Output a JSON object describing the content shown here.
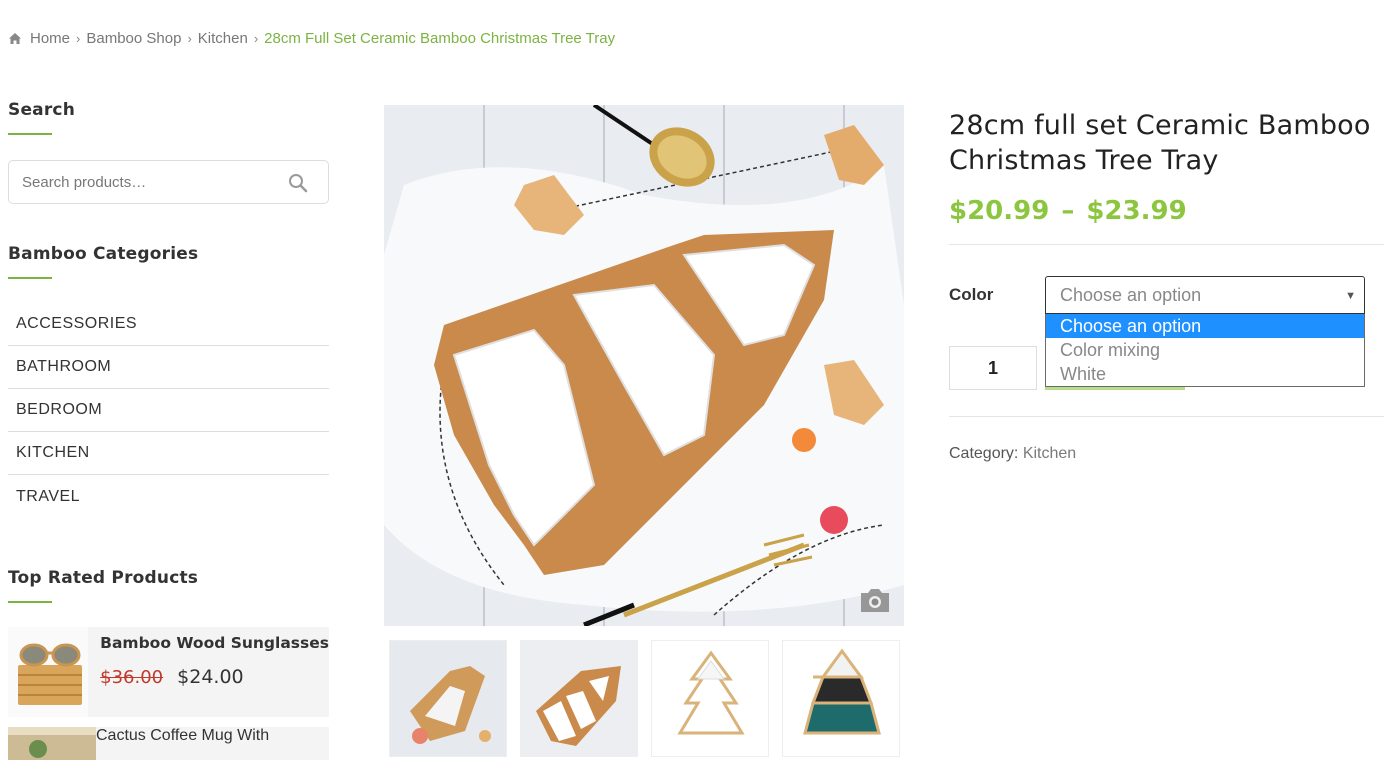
{
  "breadcrumb": {
    "home": "Home",
    "shop": "Bamboo Shop",
    "category": "Kitchen",
    "current": "28cm Full Set Ceramic Bamboo Christmas Tree Tray"
  },
  "sidebar": {
    "search": {
      "title": "Search",
      "placeholder": "Search products…"
    },
    "categories": {
      "title": "Bamboo Categories",
      "items": [
        "ACCESSORIES",
        "BATHROOM",
        "BEDROOM",
        "KITCHEN",
        "TRAVEL"
      ]
    },
    "top_rated": {
      "title": "Top Rated Products",
      "products": [
        {
          "name": "Bamboo Wood Sunglasses",
          "old_price": "$36.00",
          "price": "$24.00"
        },
        {
          "name": "Cactus Coffee Mug With"
        }
      ]
    }
  },
  "product": {
    "title": "28cm full set Ceramic Bamboo Christmas Tree Tray",
    "price_min": "$20.99",
    "price_sep": "–",
    "price_max": "$23.99",
    "variation_label": "Color",
    "select_value": "Choose an option",
    "options": [
      "Choose an option",
      "Color mixing",
      "White"
    ],
    "quantity": "1",
    "category_label": "Category:",
    "category_value": "Kitchen"
  },
  "colors": {
    "accent_green": "#8cc63f",
    "link_green": "#7cb342",
    "option_highlight": "#1e90ff",
    "old_price_red": "#c0392b"
  }
}
